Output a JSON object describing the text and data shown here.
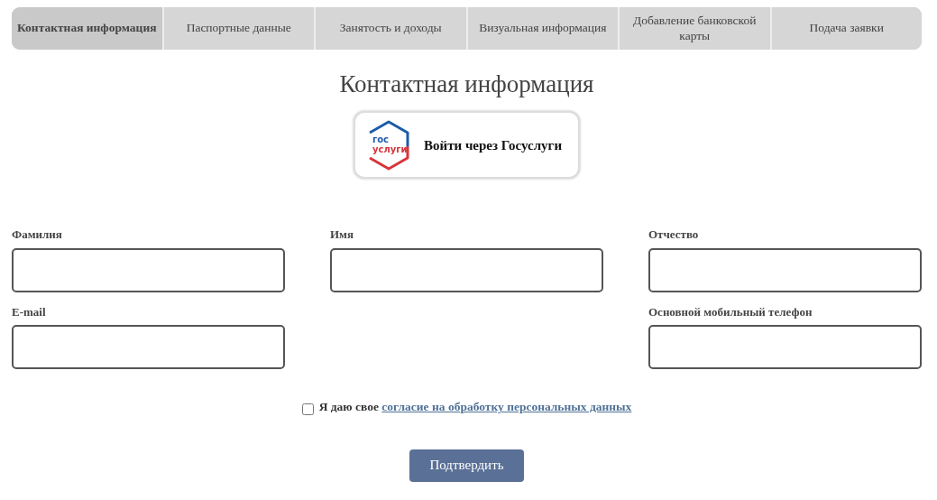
{
  "tabs": [
    {
      "label": "Контактная информация",
      "selected": true
    },
    {
      "label": "Паспортные данные",
      "selected": false
    },
    {
      "label": "Занятость и доходы",
      "selected": false
    },
    {
      "label": "Визуальная информация",
      "selected": false
    },
    {
      "label": "Добавление банковской карты",
      "selected": false
    },
    {
      "label": "Подача заявки",
      "selected": false
    }
  ],
  "heading": "Контактная информация",
  "gosuslugi_button": {
    "logo_top": "гос",
    "logo_bottom": "услуги",
    "label": "Войти через Госуслуги"
  },
  "form_rows": [
    {
      "fields": [
        {
          "label": "Фамилия"
        },
        {
          "label": "Имя"
        },
        {
          "label": "Отчество"
        }
      ]
    },
    {
      "fields": [
        {
          "label": "E-mail"
        },
        {
          "label": "Основной мобильный телефон"
        }
      ]
    }
  ],
  "consent": {
    "checked": false,
    "text": "Я даю свое",
    "link": "согласие на обработку персональных данных"
  },
  "submit_button": "Подтвердить"
}
